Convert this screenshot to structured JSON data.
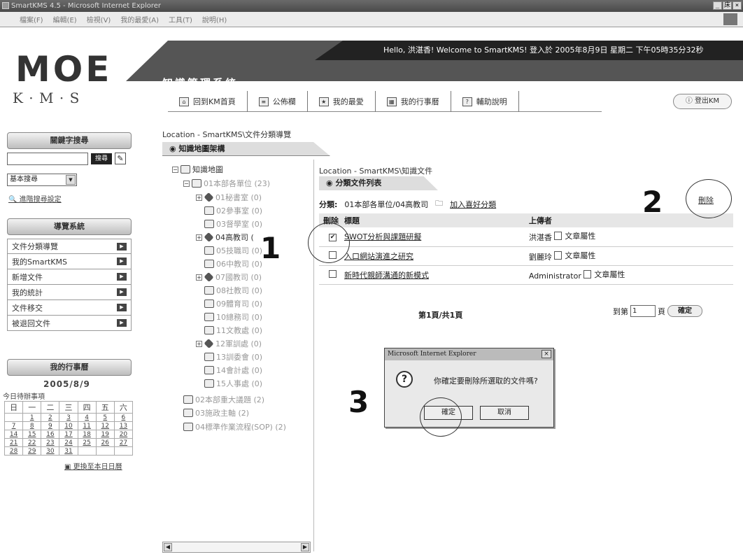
{
  "window": {
    "title": "SmartKMS 4.5 - Microsoft Internet Explorer",
    "controls": [
      "_",
      "床",
      "×"
    ]
  },
  "menu": [
    "檔案(F)",
    "編輯(E)",
    "檢視(V)",
    "我的最愛(A)",
    "工具(T)",
    "說明(H)"
  ],
  "header": {
    "logo_main": "MOE",
    "logo_sub": "K · M · S",
    "greeting": "Hello, 洪湛香! Welcome to SmartKMS!   登入於 2005年8月9日 星期二 下午05時35分32秒",
    "system_title": "知識管理系統",
    "nav": [
      {
        "label": "回到KM首頁",
        "icon": "home-icon"
      },
      {
        "label": "公佈欄",
        "icon": "bulletin-icon"
      },
      {
        "label": "我的最愛",
        "icon": "favorites-icon"
      },
      {
        "label": "我的行事曆",
        "icon": "calendar-icon"
      },
      {
        "label": "輔助說明",
        "icon": "help-icon"
      }
    ],
    "logout": "登出KM"
  },
  "sidebar": {
    "search_title": "關鍵字搜尋",
    "search_button": "搜尋",
    "search_mode": "基本搜尋",
    "advanced_link": "進階搜尋設定",
    "nav_title": "導覽系統",
    "nav_items": [
      "文件分類導覽",
      "我的SmartKMS",
      "新增文件",
      "我的統計",
      "文件移交",
      "被退回文件"
    ],
    "calendar_title": "我的行事曆",
    "calendar_date": "2005/8/9",
    "todo_label": "今日待辦事項",
    "weekdays": [
      "日",
      "一",
      "二",
      "三",
      "四",
      "五",
      "六"
    ],
    "weeks": [
      [
        "",
        "1",
        "2",
        "3",
        "4",
        "5",
        "6"
      ],
      [
        "7",
        "8",
        "9",
        "10",
        "11",
        "12",
        "13"
      ],
      [
        "14",
        "15",
        "16",
        "17",
        "18",
        "19",
        "20"
      ],
      [
        "21",
        "22",
        "23",
        "24",
        "25",
        "26",
        "27"
      ],
      [
        "28",
        "29",
        "30",
        "31",
        "",
        "",
        ""
      ]
    ],
    "calendar_link": "更換至本日日曆"
  },
  "tree": {
    "location": "Location - SmartKMS\\文件分類導覽",
    "tab": "知識地圖架構",
    "items": [
      {
        "label": "知識地圖",
        "toggle": "⊟",
        "icon": "book-icon",
        "dark": true
      },
      {
        "label": "01本部各單位 (23)",
        "toggle": "⊟",
        "icon": "book-icon",
        "dark": false
      },
      {
        "label": "01秘書室 (0)",
        "toggle": "⊞",
        "icon": "gem-icon",
        "dark": false
      },
      {
        "label": "02參事室 (0)",
        "toggle": "",
        "icon": "book-icon",
        "dark": false
      },
      {
        "label": "03督學室 (0)",
        "toggle": "",
        "icon": "book-icon",
        "dark": false
      },
      {
        "label": "04高教司 (",
        "toggle": "⊞",
        "icon": "gem-icon",
        "dark": true
      },
      {
        "label": "05技職司 (0)",
        "toggle": "",
        "icon": "book-icon",
        "dark": false
      },
      {
        "label": "06中教司 (0)",
        "toggle": "",
        "icon": "book-icon",
        "dark": false
      },
      {
        "label": "07國教司 (0)",
        "toggle": "⊞",
        "icon": "gem-icon",
        "dark": false
      },
      {
        "label": "08社教司 (0)",
        "toggle": "",
        "icon": "book-icon",
        "dark": false
      },
      {
        "label": "09體育司 (0)",
        "toggle": "",
        "icon": "book-icon",
        "dark": false
      },
      {
        "label": "10總務司 (0)",
        "toggle": "",
        "icon": "book-icon",
        "dark": false
      },
      {
        "label": "11文教處 (0)",
        "toggle": "",
        "icon": "book-icon",
        "dark": false
      },
      {
        "label": "12軍訓處 (0)",
        "toggle": "⊞",
        "icon": "gem-icon",
        "dark": false
      },
      {
        "label": "13訓委會 (0)",
        "toggle": "",
        "icon": "book-icon",
        "dark": false
      },
      {
        "label": "14會計處 (0)",
        "toggle": "",
        "icon": "book-icon",
        "dark": false
      },
      {
        "label": "15人事處 (0)",
        "toggle": "",
        "icon": "book-icon",
        "dark": false
      },
      {
        "label": "02本部重大議題 (2)",
        "toggle": "",
        "icon": "book-icon",
        "dark": false
      },
      {
        "label": "03施政主軸 (2)",
        "toggle": "",
        "icon": "book-icon",
        "dark": false
      },
      {
        "label": "04標準作業流程(SOP) (2)",
        "toggle": "",
        "icon": "book-icon",
        "dark": false
      }
    ]
  },
  "docs": {
    "location": "Location - SmartKMS\\知識文件",
    "tab": "分類文件列表",
    "category_label": "分類:",
    "category_path": "01本部各單位/04高教司",
    "add_favorite": "加入喜好分類",
    "delete_link": "刪除",
    "columns": [
      "刪除",
      "標題",
      "上傳者"
    ],
    "rows": [
      {
        "checked": true,
        "title": "SWOT分析與課題研擬",
        "uploader": "洪湛香",
        "prop": "文章屬性"
      },
      {
        "checked": false,
        "title": "入口網站演進之研究",
        "uploader": "劉麗玲",
        "prop": "文章屬性"
      },
      {
        "checked": false,
        "title": "新時代親師溝通的新模式",
        "uploader": "Administrator",
        "prop": "文章屬性"
      }
    ],
    "pager": "第1頁/共1頁",
    "goto_pre": "到第",
    "goto_page": "1",
    "goto_post": "頁",
    "goto_ok": "確定"
  },
  "dialog": {
    "title": "Microsoft Internet Explorer",
    "message": "你確定要刪除所選取的文件嗎?",
    "ok": "確定",
    "cancel": "取消",
    "close": "×"
  },
  "annotations": [
    "1",
    "2",
    "3"
  ]
}
